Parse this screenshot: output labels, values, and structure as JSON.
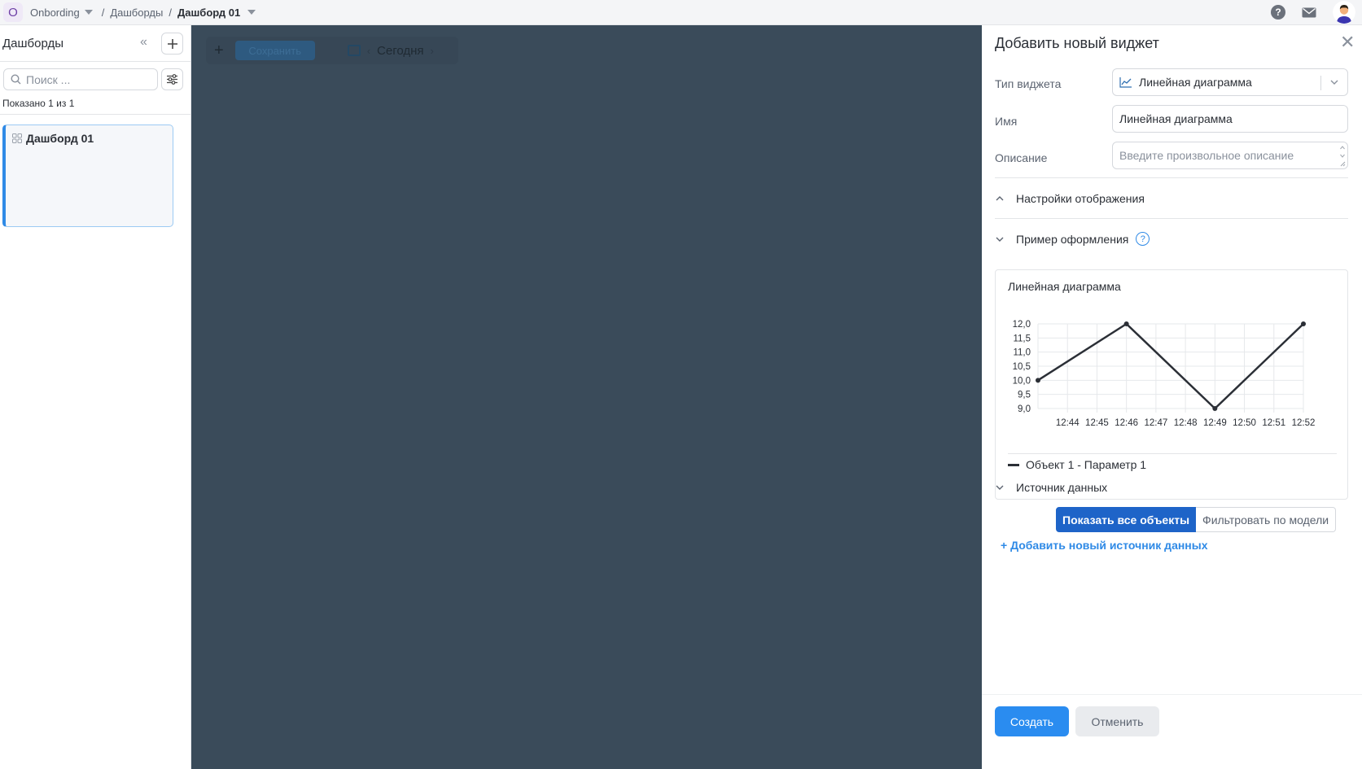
{
  "topbar": {
    "workspace_badge": "O",
    "breadcrumbs": [
      "Onbording",
      "Дашборды",
      "Дашборд 01"
    ],
    "separator": "/",
    "help_icon": "?"
  },
  "sidebar": {
    "title": "Дашборды",
    "search_placeholder": "Поиск ...",
    "shown_prefix": "Показано ",
    "shown_count": "1 из 1",
    "dashboards": [
      {
        "label": "Дашборд 01"
      }
    ]
  },
  "overlay": {
    "toolbar_button": "Сохранить",
    "today_label": "Сегодня"
  },
  "panel": {
    "title": "Добавить новый виджет",
    "fields": {
      "type_label": "Тип виджета",
      "type_value": "Линейная диаграмма",
      "name_label": "Имя",
      "name_value": "Линейная диаграмма",
      "description_label": "Описание",
      "description_placeholder": "Введите произвольное описание"
    },
    "sections": {
      "display_settings": "Настройки отображения",
      "preview": "Пример оформления",
      "data_source": "Источник данных"
    },
    "preview_title": "Линейная диаграмма",
    "data_source": {
      "show_all": "Показать все объекты",
      "filter_model": "Фильтровать по модели",
      "add_source": "+ Добавить новый источник данных"
    },
    "footer": {
      "create": "Создать",
      "cancel": "Отменить"
    }
  },
  "colors": {
    "primary": "#2a8cf0",
    "active_segment": "#1e64c8",
    "overlay": "#3a4b5a",
    "link": "#2f8ae6"
  },
  "chart_data": {
    "type": "line",
    "title": "Линейная диаграмма",
    "categories": [
      "12:44",
      "12:45",
      "12:46",
      "12:47",
      "12:48",
      "12:49",
      "12:50",
      "12:51",
      "12:52"
    ],
    "y_ticks": [
      "9,0",
      "9,5",
      "10,0",
      "10,5",
      "11,0",
      "11,5",
      "12,0"
    ],
    "ylim": [
      9.0,
      12.0
    ],
    "grid": true,
    "series": [
      {
        "name": "Объект 1 - Параметр 1",
        "points": [
          {
            "x": "12:43",
            "y": 10.0
          },
          {
            "x": "12:46",
            "y": 12.0
          },
          {
            "x": "12:49",
            "y": 9.0
          },
          {
            "x": "12:52",
            "y": 12.0
          }
        ]
      }
    ]
  }
}
